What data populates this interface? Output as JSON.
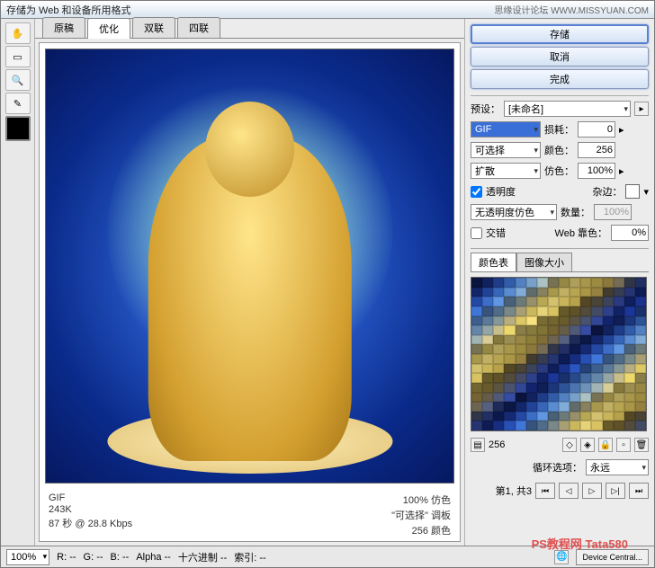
{
  "title": "存储为 Web 和设备所用格式",
  "watermark_right": "思缘设计论坛 WWW.MISSYUAN.COM",
  "tabs": [
    "原稿",
    "优化",
    "双联",
    "四联"
  ],
  "active_tab": 1,
  "buttons": {
    "save": "存储",
    "cancel": "取消",
    "done": "完成"
  },
  "preset": {
    "label": "预设：",
    "value": "[未命名]"
  },
  "format": {
    "value": "GIF"
  },
  "loss": {
    "label": "损耗：",
    "value": "0"
  },
  "reduction": {
    "value": "可选择"
  },
  "colors": {
    "label": "颜色：",
    "value": "256"
  },
  "dither_method": {
    "value": "扩散"
  },
  "dither": {
    "label": "仿色：",
    "value": "100%"
  },
  "transparency": {
    "label": "透明度",
    "checked": true
  },
  "matte": {
    "label": "杂边："
  },
  "trans_dither": {
    "value": "无透明度仿色"
  },
  "amount": {
    "label": "数量：",
    "value": "100%"
  },
  "interlace": {
    "label": "交错",
    "checked": false
  },
  "web": {
    "label": "Web 靠色：",
    "value": "0%"
  },
  "palette_tabs": [
    "颜色表",
    "图像大小"
  ],
  "palette_count": "256",
  "loop": {
    "label": "循环选项：",
    "value": "永远"
  },
  "page_info": "第1, 共3",
  "info": {
    "format": "GIF",
    "size": "243K",
    "time": "87 秒 @ 28.8 Kbps",
    "dither_info": "100% 仿色",
    "palette_info": "\"可选择\" 调板",
    "color_info": "256 颜色"
  },
  "status": {
    "zoom": "100%",
    "r": "R: --",
    "g": "G: --",
    "b": "B: --",
    "alpha": "Alpha --",
    "hex": "十六进制 --",
    "index": "索引: --",
    "device": "Device Central..."
  },
  "bottom_watermark": "PS教程网 Tata580"
}
